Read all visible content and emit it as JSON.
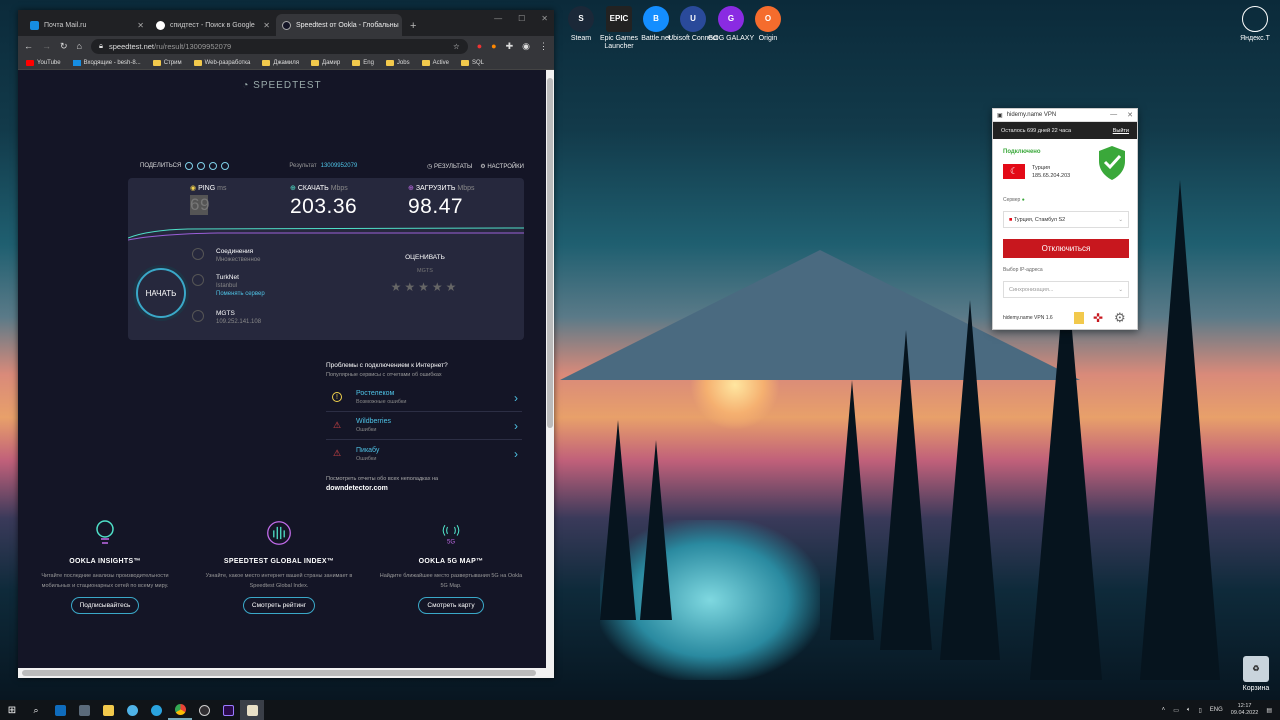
{
  "desktop": {
    "icons": [
      {
        "label": "Steam",
        "color": "#1b2838"
      },
      {
        "label": "Epic Games Launcher",
        "color": "#222222"
      },
      {
        "label": "Battle.net",
        "color": "#148eff"
      },
      {
        "label": "Ubisoft Connect",
        "color": "#2a4a9a"
      },
      {
        "label": "GOG GALAXY",
        "color": "#8a2be2"
      },
      {
        "label": "Origin",
        "color": "#f56c2d"
      }
    ],
    "recycle_bin": "Корзина",
    "yandex": "Яндекс.Т"
  },
  "browser": {
    "tabs": [
      {
        "title": "Почта Mail.ru"
      },
      {
        "title": "спидтест - Поиск в Google"
      },
      {
        "title": "Speedtest от Ookla - Глобальны"
      }
    ],
    "url_host": "speedtest.net",
    "url_path": "/ru/result/13009952079",
    "bookmarks": [
      "YouTube",
      "Входящие - besh-8...",
      "Стрим",
      "Web-разработка",
      "Джамиля",
      "Дамир",
      "Eng",
      "Jobs",
      "Active",
      "SQL"
    ]
  },
  "speedtest": {
    "logo": "SPEEDTEST",
    "share": "ПОДЕЛИТЬСЯ",
    "result_label": "Результат",
    "result_id": "13009952079",
    "results_btn": "РЕЗУЛЬТАТЫ",
    "settings_btn": "НАСТРОЙКИ",
    "ping": {
      "label": "PING",
      "unit": "ms",
      "value": "69"
    },
    "download": {
      "label": "СКАЧАТЬ",
      "unit": "Mbps",
      "value": "203.36"
    },
    "upload": {
      "label": "ЗАГРУЗИТЬ",
      "unit": "Mbps",
      "value": "98.47"
    },
    "go": "НАЧАТЬ",
    "connections": {
      "title": "Соединения",
      "sub": "Множественное"
    },
    "server": {
      "title": "TurkNet",
      "sub": "Istanbul",
      "link": "Поменять сервер"
    },
    "provider": {
      "title": "MGTS",
      "sub": "109.252.141.108"
    },
    "rate": {
      "title": "ОЦЕНИВАТЬ",
      "sub": "MGTS",
      "stars": "★★★★★"
    },
    "problems": {
      "title": "Проблемы с подключением к Интернет?",
      "sub": "Популярные сервисы с отчетами об ошибках",
      "items": [
        {
          "name": "Ростелеком",
          "status": "Возможные ошибки",
          "icon": "!"
        },
        {
          "name": "Wildberries",
          "status": "Ошибки",
          "icon": "⚠"
        },
        {
          "name": "Пикабу",
          "status": "Ошибки",
          "icon": "⚠"
        }
      ]
    },
    "downdetector": {
      "text": "Посмотреть отчеты обо всех неполадках на",
      "link": "downdetector.com"
    },
    "features": [
      {
        "title": "OOKLA INSIGHTS™",
        "desc": "Читайте последние анализы производительности мобильных и стационарных сетей по всему миру.",
        "btn": "Подписывайтесь"
      },
      {
        "title": "SPEEDTEST GLOBAL INDEX™",
        "desc": "Узнайте, какое место интернет вашей страны занимает в Speedtest Global Index.",
        "btn": "Смотреть рейтинг"
      },
      {
        "title": "OOKLA 5G MAP™",
        "desc": "Найдите ближайшее место развертывания 5G на Ookla 5G Map.",
        "btn": "Смотреть карту"
      }
    ]
  },
  "vpn": {
    "title": "hidemy.name VPN",
    "remaining": "Осталось 699 дней 22 часа",
    "logout": "Выйти",
    "status": "Подключено",
    "country": "Турция",
    "ip": "185.65.204.203",
    "server_label": "Сервер",
    "server_value": "Турция, Стамбул S2",
    "disconnect": "Отключиться",
    "ip_label": "Выбор IP-адреса",
    "ip_value": "Синхронизация...",
    "version": "hidemy.name VPN 1.6",
    "accent": "#c8171e",
    "ok_color": "#3aa83a"
  },
  "taskbar": {
    "lang": "ENG",
    "time": "12:17",
    "date": "09.04.2022"
  }
}
